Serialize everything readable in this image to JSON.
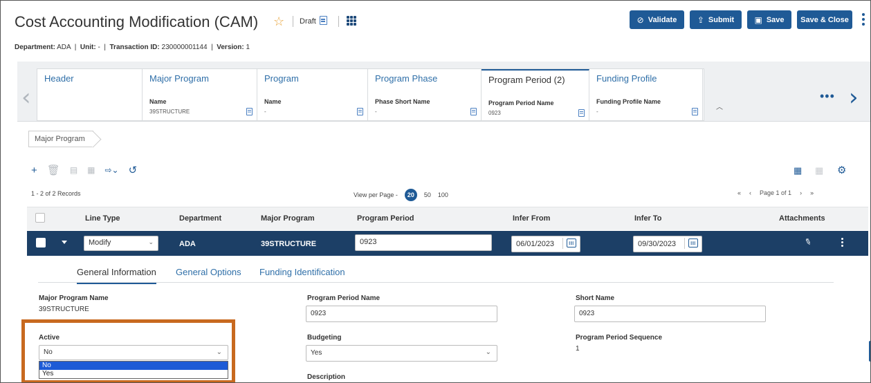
{
  "header": {
    "title": "Cost Accounting Modification (CAM)",
    "status": "Draft",
    "dept_label": "Department:",
    "dept_value": "ADA",
    "unit_label": "Unit:",
    "unit_value": "-",
    "txn_label": "Transaction ID:",
    "txn_value": "230000001144",
    "version_label": "Version:",
    "version_value": "1"
  },
  "actions": {
    "validate": "Validate",
    "submit": "Submit",
    "save": "Save",
    "save_close": "Save & Close"
  },
  "tabs": [
    {
      "title": "Header",
      "label": "",
      "value": ""
    },
    {
      "title": "Major Program",
      "label": "Name",
      "value": "39STRUCTURE"
    },
    {
      "title": "Program",
      "label": "Name",
      "value": "-"
    },
    {
      "title": "Program Phase",
      "label": "Phase Short Name",
      "value": "-"
    },
    {
      "title": "Program Period (2)",
      "label": "Program Period Name",
      "value": "0923"
    },
    {
      "title": "Funding Profile",
      "label": "Funding Profile Name",
      "value": "-"
    }
  ],
  "breadcrumb": "Major Program",
  "grid": {
    "records": "1 - 2 of 2 Records",
    "view_per_page_label": "View per Page -",
    "page_sizes": [
      "20",
      "50",
      "100"
    ],
    "page_info": "Page 1 of 1",
    "columns": [
      "Line Type",
      "Department",
      "Major Program",
      "Program Period",
      "Infer From",
      "Infer To",
      "Attachments"
    ],
    "row": {
      "line_type": "Modify",
      "department": "ADA",
      "major_program": "39STRUCTURE",
      "program_period": "0923",
      "infer_from": "06/01/2023",
      "infer_to": "09/30/2023"
    }
  },
  "detail": {
    "tabs": [
      "General Information",
      "General Options",
      "Funding Identification"
    ],
    "major_program_name_label": "Major Program Name",
    "major_program_name_value": "39STRUCTURE",
    "program_period_name_label": "Program Period Name",
    "program_period_name_value": "0923",
    "short_name_label": "Short Name",
    "short_name_value": "0923",
    "active_label": "Active",
    "active_value": "No",
    "active_options": [
      "No",
      "Yes"
    ],
    "budgeting_label": "Budgeting",
    "budgeting_value": "Yes",
    "sequence_label": "Program Period Sequence",
    "sequence_value": "1",
    "description_label": "Description"
  },
  "colors": {
    "primary": "#1f5a96",
    "row_selected": "#1c3f66",
    "highlight_box": "#c8691f",
    "star": "#e8a33a"
  }
}
